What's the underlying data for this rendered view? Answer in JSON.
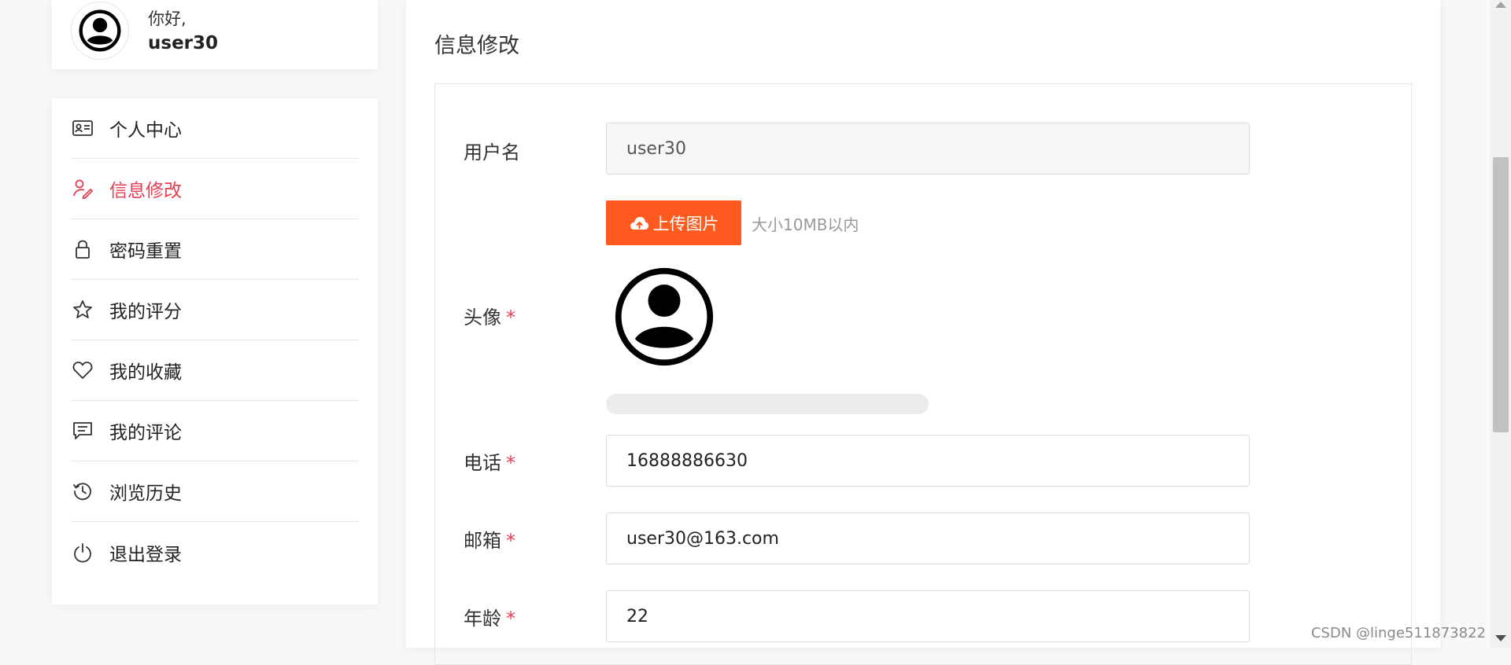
{
  "header": {
    "greeting": "你好,",
    "username": "user30"
  },
  "sidebar": {
    "items": [
      {
        "label": "个人中心",
        "icon": "id-card-icon",
        "active": false
      },
      {
        "label": "信息修改",
        "icon": "user-edit-icon",
        "active": true
      },
      {
        "label": "密码重置",
        "icon": "lock-icon",
        "active": false
      },
      {
        "label": "我的评分",
        "icon": "star-icon",
        "active": false
      },
      {
        "label": "我的收藏",
        "icon": "heart-icon",
        "active": false
      },
      {
        "label": "我的评论",
        "icon": "comment-icon",
        "active": false
      },
      {
        "label": "浏览历史",
        "icon": "history-icon",
        "active": false
      },
      {
        "label": "退出登录",
        "icon": "power-icon",
        "active": false
      }
    ]
  },
  "main": {
    "title": "信息修改",
    "form": {
      "username": {
        "label": "用户名",
        "value": "user30"
      },
      "avatar": {
        "label": "头像",
        "upload_label": "上传图片",
        "upload_hint": "大小10MB以内",
        "upload_progress": 0
      },
      "phone": {
        "label": "电话",
        "value": "16888886630"
      },
      "email": {
        "label": "邮箱",
        "value": "user30@163.com"
      },
      "age": {
        "label": "年龄",
        "value": "22"
      },
      "required_mark": "*"
    }
  },
  "watermark": "CSDN @linge511873822",
  "colors": {
    "accent": "#e63f52",
    "upload_button": "#ff5a1f"
  }
}
